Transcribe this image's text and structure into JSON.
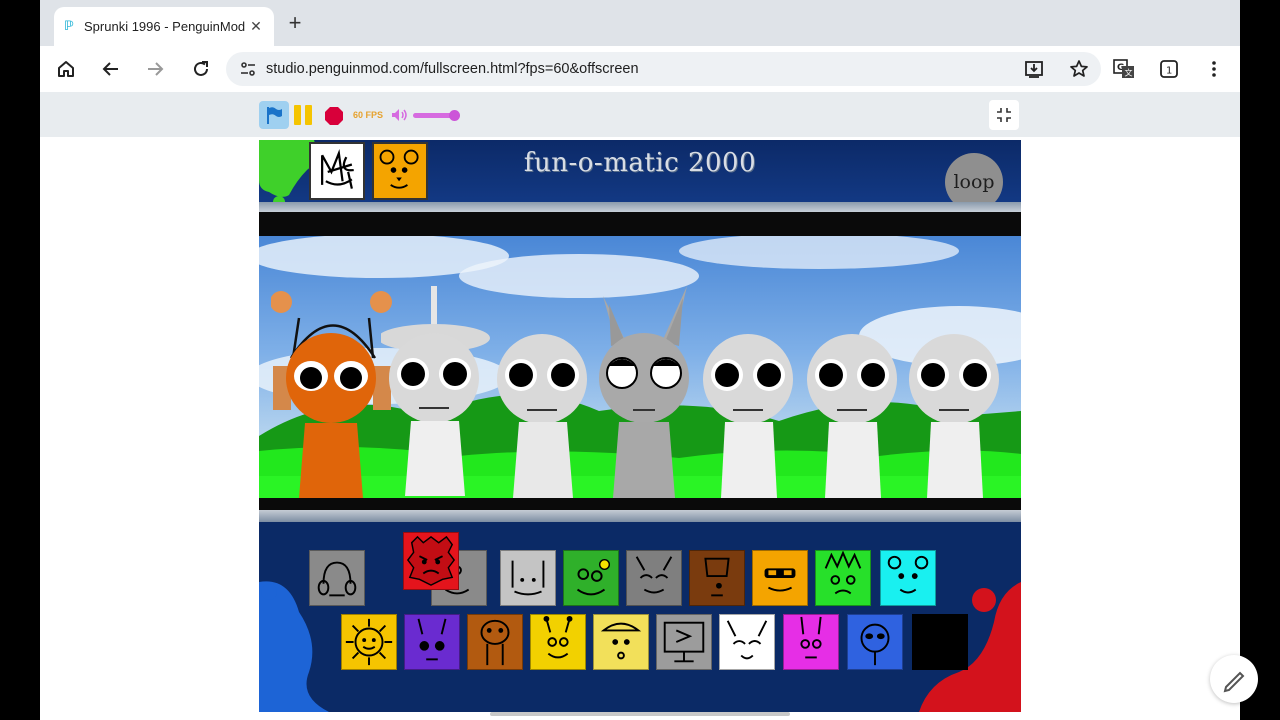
{
  "browser": {
    "tab": {
      "title": "Sprunki 1996 - PenguinMod",
      "favicon": "penguinmod-favicon",
      "close": "✕"
    },
    "new_tab": "+",
    "address": {
      "url": "studio.penguinmod.com/fullscreen.html?fps=60&offscreen"
    },
    "toolbar_icons": [
      "home-icon",
      "back-icon",
      "forward-icon",
      "reload-icon",
      "site-info-icon",
      "install-app-icon",
      "bookmark-star-icon",
      "translate-icon",
      "tab-count-icon",
      "menu-icon"
    ],
    "tab_count": "1"
  },
  "player": {
    "fps_label": "60 FPS",
    "volume_level": 0.8,
    "colors": {
      "flag": "#1a73c9",
      "pause": "#f5c400",
      "stop": "#d8003a",
      "volume": "#d66be0"
    }
  },
  "game": {
    "title": "fun-o-matic 2000",
    "loop_label": "loop",
    "top_icons": [
      "scribble-character-icon",
      "orange-bear-icon"
    ],
    "characters": [
      {
        "name": "orange-antenna-character",
        "color": "#e0650a"
      },
      {
        "name": "gray-hat-character",
        "color": "#d9d9d9"
      },
      {
        "name": "gray-character-3",
        "color": "#d9d9d9"
      },
      {
        "name": "gray-cat-ears-character",
        "color": "#a8a8a8"
      },
      {
        "name": "gray-character-5",
        "color": "#d9d9d9"
      },
      {
        "name": "gray-character-6",
        "color": "#d9d9d9"
      },
      {
        "name": "gray-character-7",
        "color": "#d9d9d9"
      }
    ],
    "icon_row_1": [
      {
        "name": "gray-headphones-icon",
        "color": "#8a8a8a"
      },
      {
        "name": "red-angry-icon",
        "color": "#e4141c"
      },
      {
        "name": "light-gray-icon",
        "color": "#c4c4c4"
      },
      {
        "name": "green-flower-icon",
        "color": "#2fb02a"
      },
      {
        "name": "gray-cat-icon",
        "color": "#7f7f7f"
      },
      {
        "name": "brown-icon",
        "color": "#7a3b0e"
      },
      {
        "name": "orange-glasses-icon",
        "color": "#f4a400"
      },
      {
        "name": "lime-spiky-icon",
        "color": "#27e02a"
      },
      {
        "name": "cyan-bear-icon",
        "color": "#19f0f0"
      }
    ],
    "icon_row_2": [
      {
        "name": "yellow-sun-icon",
        "color": "#f5c400"
      },
      {
        "name": "purple-icon",
        "color": "#6a2bd0"
      },
      {
        "name": "brown-tall-icon",
        "color": "#b25a10"
      },
      {
        "name": "yellow-antenna-icon",
        "color": "#f2d100"
      },
      {
        "name": "yellow-hat-icon",
        "color": "#f2e05a"
      },
      {
        "name": "gray-tv-icon",
        "color": "#9c9c9c"
      },
      {
        "name": "white-cat-icon",
        "color": "#ffffff"
      },
      {
        "name": "magenta-bunny-icon",
        "color": "#e62ee6"
      },
      {
        "name": "blue-alien-icon",
        "color": "#2f62e0"
      },
      {
        "name": "black-icon",
        "color": "#000000"
      }
    ]
  }
}
